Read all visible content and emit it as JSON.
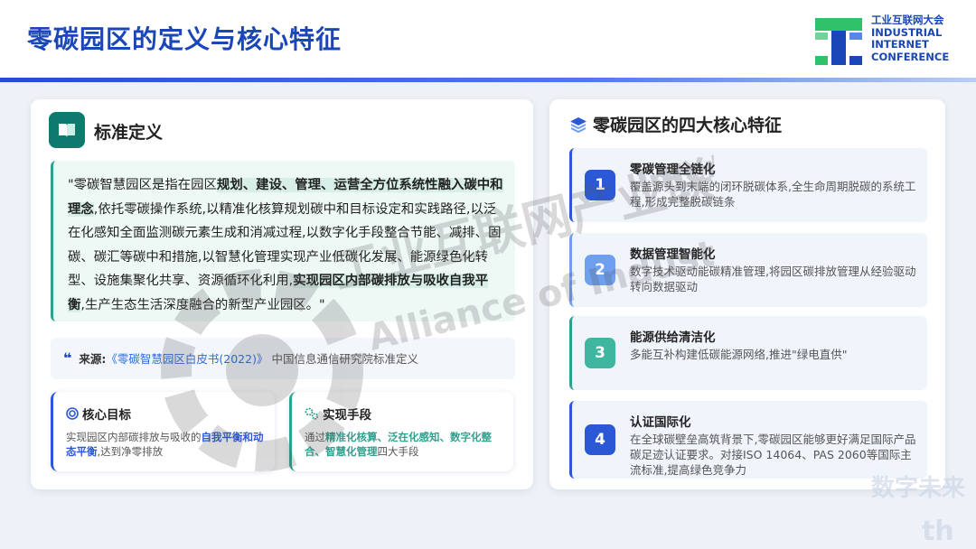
{
  "header": {
    "title": "零碳园区的定义与核心特征",
    "logo_lines": [
      "工业互联网大会",
      "INDUSTRIAL",
      "INTERNET",
      "CONFERENCE"
    ]
  },
  "definition": {
    "title": "标准定义",
    "icon": "book-icon",
    "quote": {
      "p1": "\"零碳智慧园区是指在园区",
      "h1": "规划、建设、管理、运营全方位系统性融入碳中和理念",
      "p2": ",依托零碳操作系统,以精准化核算规划碳中和目标设定和实践路径,以泛在化感知全面监测碳元素生成和消减过程,以数字化手段整合节能、减排、固碳、碳汇等碳中和措施,以智慧化管理实现产业低碳化发展、能源绿色化转型、设施集聚化共享、资源循环化利用,",
      "h2": "实现园区内部碳排放与吸收自我平衡",
      "p3": ",生产生态生活深度融合的新型产业园区。\""
    },
    "source": {
      "quote_mark": "❝",
      "label": "来源:",
      "book": "《零碳智慧园区白皮书(2022)》",
      "org": "中国信息通信研究院标准定义"
    },
    "cards": [
      {
        "title": "核心目标",
        "icon": "target-icon",
        "pre": "实现园区内部碳排放与吸收的",
        "hl": "自我平衡和动态平衡",
        "post": ",达到净零排放"
      },
      {
        "title": "实现手段",
        "icon": "gears-icon",
        "pre": "通过",
        "hl": "精准化核算、泛在化感知、数字化整合、智慧化管理",
        "post": "四大手段"
      }
    ]
  },
  "features": {
    "title": "零碳园区的四大核心特征",
    "icon": "layers-icon",
    "items": [
      {
        "num": "1",
        "title": "零碳管理全链化",
        "desc": "覆盖源头到末端的闭环脱碳体系,全生命周期脱碳的系统工程,形成完整脱碳链条"
      },
      {
        "num": "2",
        "title": "数据管理智能化",
        "desc": "数字技术驱动能碳精准管理,将园区碳排放管理从经验驱动转向数据驱动"
      },
      {
        "num": "3",
        "title": "能源供给清洁化",
        "desc": "多能互补构建低碳能源网络,推进\"绿电直供\""
      },
      {
        "num": "4",
        "title": "认证国际化",
        "desc": "在全球碳壁垒高筑背景下,零碳园区能够更好满足国际产品碳足迹认证要求。对接ISO 14064、PAS 2060等国际主流标准,提高绿色竞争力"
      }
    ]
  },
  "watermark": {
    "cn": "工业互联网产业联盟",
    "en1": "Alliance of Industrial",
    "en2": "Internet",
    "corner1": "数字未来",
    "corner2": "th"
  },
  "colors": {
    "brand_blue": "#1b46b8",
    "teal": "#0e7a6d",
    "green_accent": "#2fa28f",
    "light_blue": "#6ea0ef"
  }
}
